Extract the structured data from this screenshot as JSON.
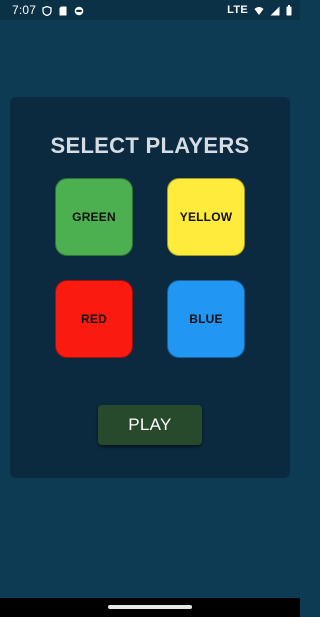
{
  "status_bar": {
    "time": "7:07",
    "network": "LTE",
    "icons": [
      "shield-icon",
      "sd-card-icon",
      "face-icon",
      "wifi-icon",
      "signal-icon",
      "battery-icon"
    ]
  },
  "screen": {
    "title": "SELECT PLAYERS",
    "players": [
      {
        "label": "GREEN",
        "color": "#4caf50"
      },
      {
        "label": "YELLOW",
        "color": "#ffeb3b"
      },
      {
        "label": "RED",
        "color": "#fb1a10"
      },
      {
        "label": "BLUE",
        "color": "#2196f3"
      }
    ],
    "play_label": "PLAY"
  },
  "colors": {
    "background": "#0d3b54",
    "card": "#0b2a40",
    "play_button": "#274a2c"
  }
}
